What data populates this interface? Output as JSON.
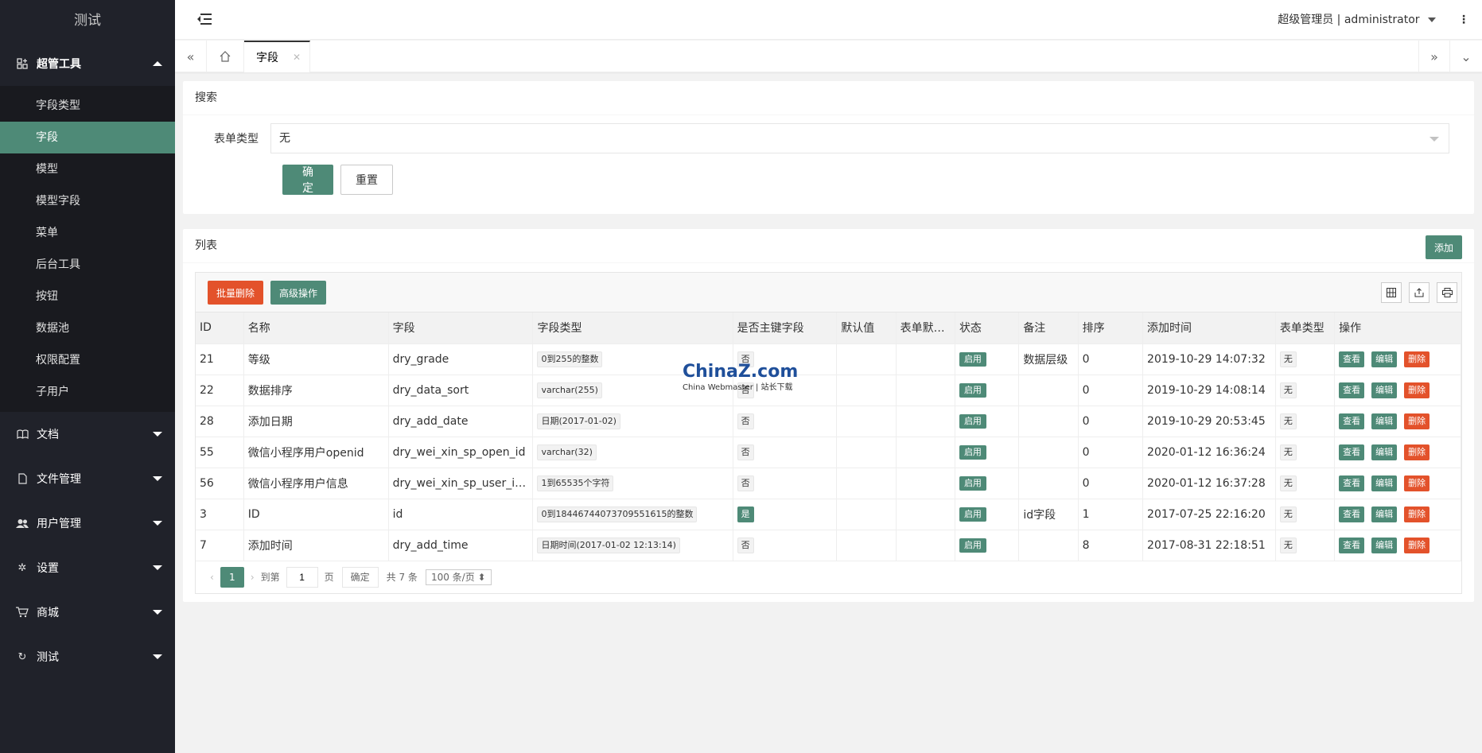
{
  "app": {
    "title": "测试"
  },
  "sidebar": {
    "groups": [
      {
        "label": "超管工具",
        "icon": "grid-icon",
        "expanded": true,
        "items": [
          "字段类型",
          "字段",
          "模型",
          "模型字段",
          "菜单",
          "后台工具",
          "按钮",
          "数据池",
          "权限配置",
          "子用户"
        ],
        "active_index": 1
      },
      {
        "label": "文档",
        "icon": "book-icon"
      },
      {
        "label": "文件管理",
        "icon": "file-icon"
      },
      {
        "label": "用户管理",
        "icon": "users-icon"
      },
      {
        "label": "设置",
        "icon": "gear-icon"
      },
      {
        "label": "商城",
        "icon": "cart-icon"
      },
      {
        "label": "测试",
        "icon": "refresh-icon"
      }
    ]
  },
  "header": {
    "user": "超级管理员 | administrator"
  },
  "tabs": {
    "active": "字段"
  },
  "search": {
    "title": "搜索",
    "form_type_label": "表单类型",
    "form_type_value": "无",
    "confirm": "确定",
    "reset": "重置"
  },
  "list": {
    "title": "列表",
    "add": "添加",
    "batch_delete": "批量删除",
    "advanced": "高级操作",
    "columns": [
      "ID",
      "名称",
      "字段",
      "字段类型",
      "是否主键字段",
      "默认值",
      "表单默认值",
      "状态",
      "备注",
      "排序",
      "添加时间",
      "表单类型",
      "操作"
    ],
    "rows": [
      {
        "id": "21",
        "name": "等级",
        "field": "dry_grade",
        "type": "0到255的整数",
        "pk": "否",
        "default": "",
        "form_default": "",
        "status": "启用",
        "note": "数据层级",
        "sort": "0",
        "time": "2019-10-29 14:07:32",
        "form_type": "无"
      },
      {
        "id": "22",
        "name": "数据排序",
        "field": "dry_data_sort",
        "type": "varchar(255)",
        "pk": "否",
        "default": "",
        "form_default": "",
        "status": "启用",
        "note": "",
        "sort": "0",
        "time": "2019-10-29 14:08:14",
        "form_type": "无"
      },
      {
        "id": "28",
        "name": "添加日期",
        "field": "dry_add_date",
        "type": "日期(2017-01-02)",
        "pk": "否",
        "default": "",
        "form_default": "",
        "status": "启用",
        "note": "",
        "sort": "0",
        "time": "2019-10-29 20:53:45",
        "form_type": "无"
      },
      {
        "id": "55",
        "name": "微信小程序用户openid",
        "field": "dry_wei_xin_sp_open_id",
        "type": "varchar(32)",
        "pk": "否",
        "default": "",
        "form_default": "",
        "status": "启用",
        "note": "",
        "sort": "0",
        "time": "2020-01-12 16:36:24",
        "form_type": "无"
      },
      {
        "id": "56",
        "name": "微信小程序用户信息",
        "field": "dry_wei_xin_sp_user_info",
        "type": "1到65535个字符",
        "pk": "否",
        "default": "",
        "form_default": "",
        "status": "启用",
        "note": "",
        "sort": "0",
        "time": "2020-01-12 16:37:28",
        "form_type": "无"
      },
      {
        "id": "3",
        "name": "ID",
        "field": "id",
        "type": "0到18446744073709551615的整数",
        "pk": "是",
        "default": "",
        "form_default": "",
        "status": "启用",
        "note": "id字段",
        "sort": "1",
        "time": "2017-07-25 22:16:20",
        "form_type": "无"
      },
      {
        "id": "7",
        "name": "添加时间",
        "field": "dry_add_time",
        "type": "日期时间(2017-01-02 12:13:14)",
        "pk": "否",
        "default": "",
        "form_default": "",
        "status": "启用",
        "note": "",
        "sort": "8",
        "time": "2017-08-31 22:18:51",
        "form_type": "无"
      }
    ],
    "ops": {
      "view": "查看",
      "edit": "编辑",
      "delete": "删除"
    },
    "pager": {
      "current": "1",
      "goto": "到第",
      "page_input": "1",
      "page_unit": "页",
      "ok": "确定",
      "total": "共 7 条",
      "per_page": "100 条/页"
    }
  },
  "watermark": {
    "brand": "ChinaZ.com",
    "sub": "China Webmaster | 站长下载"
  },
  "colors": {
    "primary": "#4e8a77",
    "danger": "#e3522b",
    "sidebar": "#20222a"
  }
}
